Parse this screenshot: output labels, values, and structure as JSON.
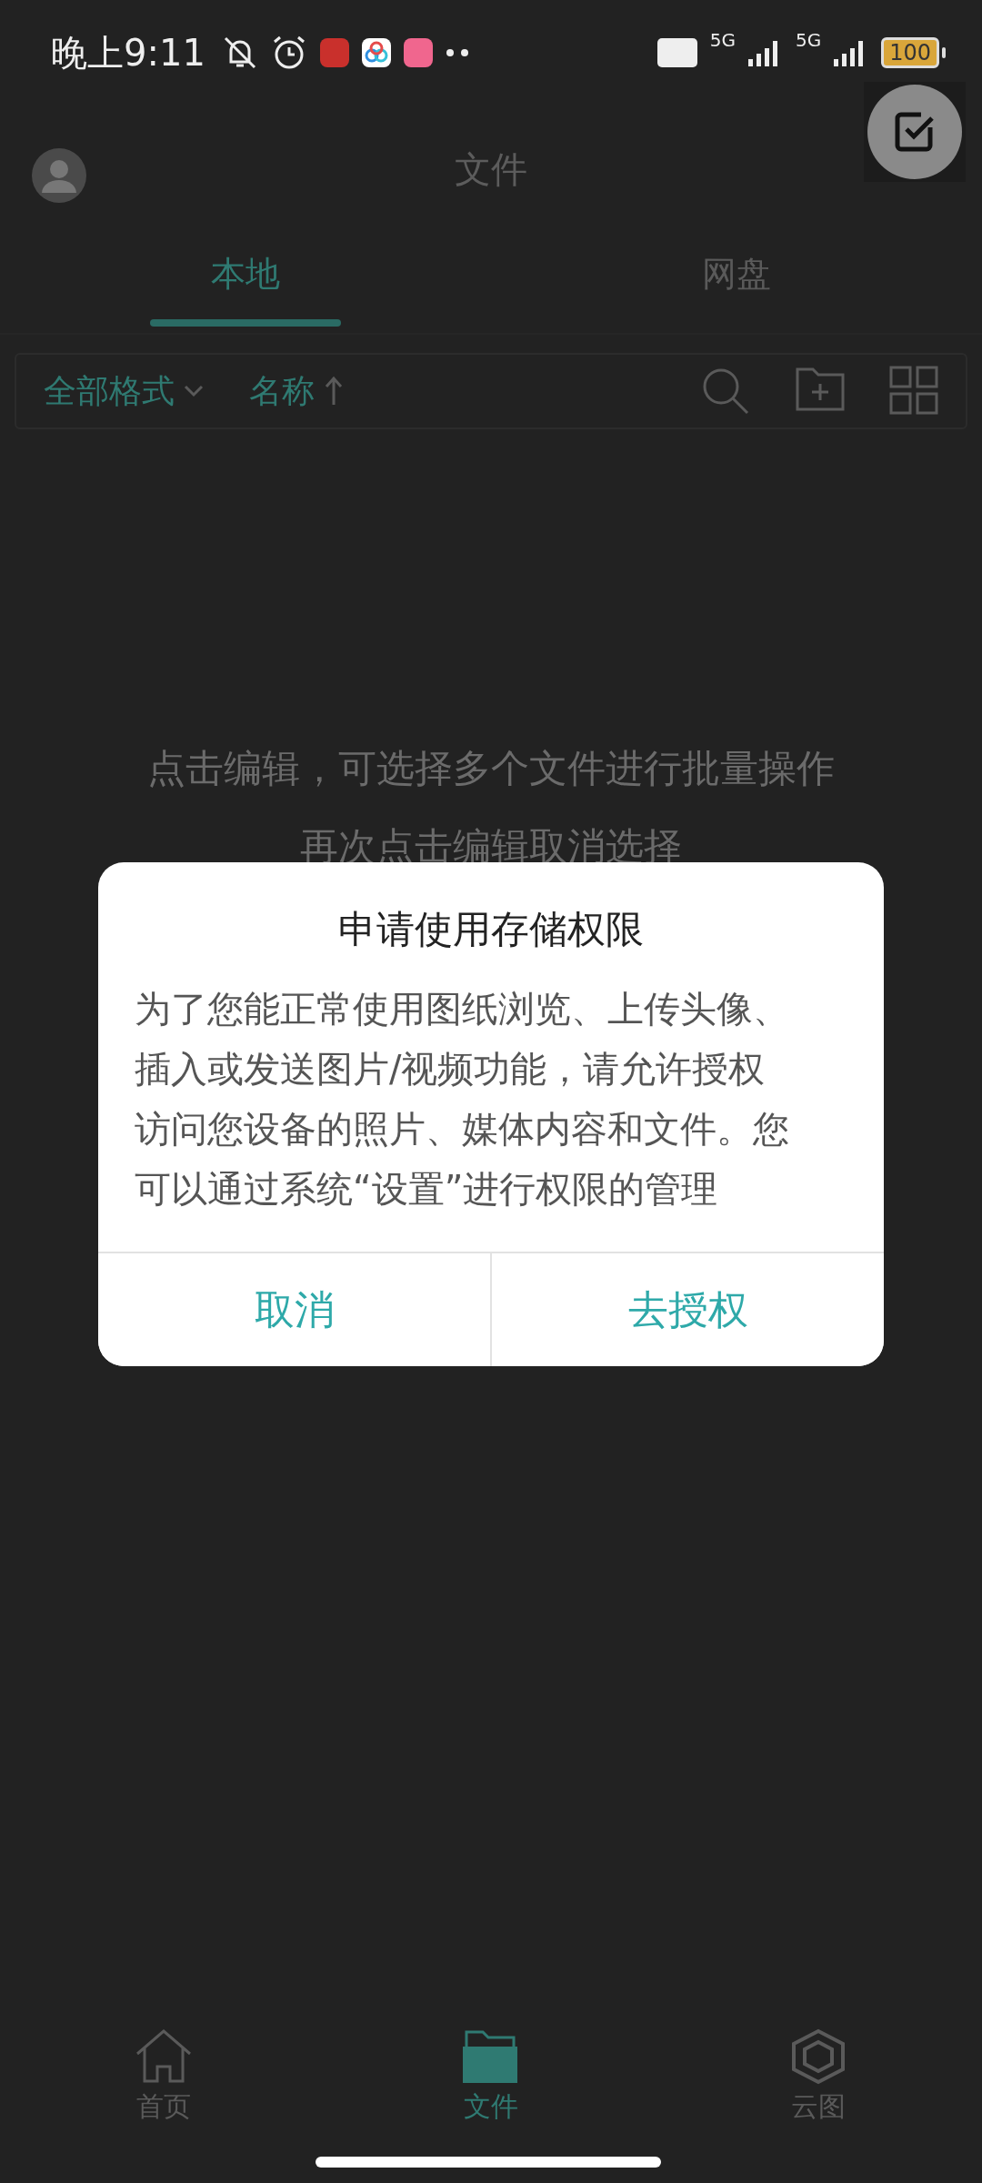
{
  "status_bar": {
    "time": "晚上9:11",
    "network_1": "5G",
    "network_2": "5G",
    "battery": "100"
  },
  "header": {
    "title": "文件"
  },
  "tabs": [
    {
      "label": "本地",
      "selected": true
    },
    {
      "label": "网盘",
      "selected": false
    }
  ],
  "toolbar": {
    "format_filter": "全部格式",
    "sort": "名称"
  },
  "hint": [
    "点击编辑，可选择多个文件进行批量操作",
    "再次点击编辑取消选择"
  ],
  "dialog": {
    "title": "申请使用存储权限",
    "message": "为了您能正常使用图纸浏览、上传头像、插入或发送图片/视频功能，请允许授权访问您设备的照片、媒体内容和文件。您可以通过系统“设置”进行权限的管理",
    "buttons": [
      "取消",
      "去授权"
    ]
  },
  "bottom_nav": [
    {
      "label": "首页",
      "kind": "home",
      "selected": false
    },
    {
      "label": "文件",
      "kind": "folder",
      "selected": true
    },
    {
      "label": "云图",
      "kind": "cloud",
      "selected": false
    }
  ]
}
